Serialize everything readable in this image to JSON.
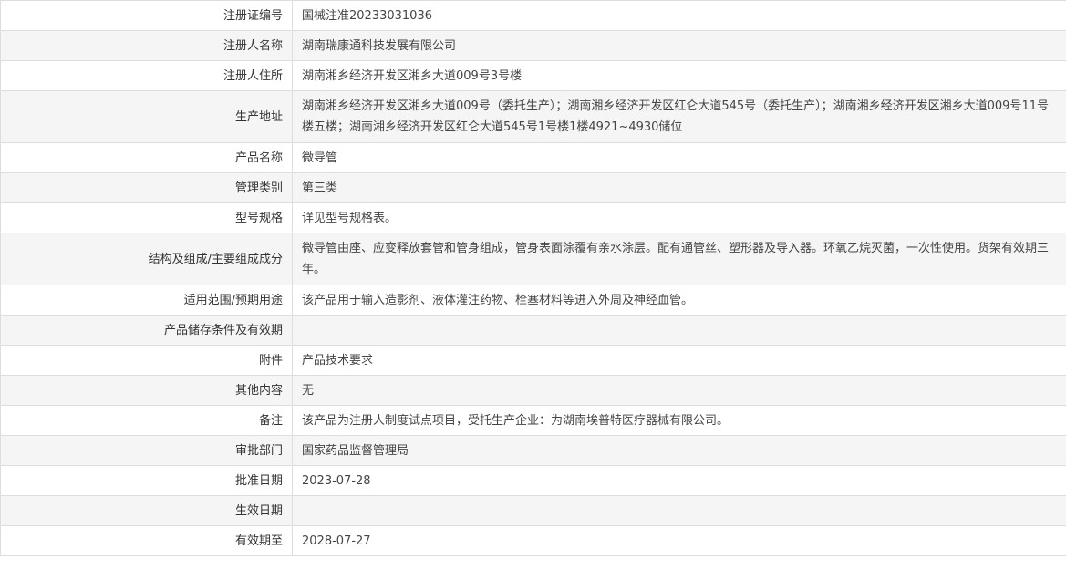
{
  "rows": [
    {
      "label": "注册证编号",
      "value": "国械注准20233031036"
    },
    {
      "label": "注册人名称",
      "value": "湖南瑞康通科技发展有限公司"
    },
    {
      "label": "注册人住所",
      "value": "湖南湘乡经济开发区湘乡大道009号3号楼"
    },
    {
      "label": "生产地址",
      "value": "湖南湘乡经济开发区湘乡大道009号（委托生产）；湖南湘乡经济开发区红仑大道545号（委托生产）；湖南湘乡经济开发区湘乡大道009号11号楼五楼；湖南湘乡经济开发区红仑大道545号1号楼1楼4921~4930储位"
    },
    {
      "label": "产品名称",
      "value": "微导管"
    },
    {
      "label": "管理类别",
      "value": "第三类"
    },
    {
      "label": "型号规格",
      "value": "详见型号规格表。"
    },
    {
      "label": "结构及组成/主要组成成分",
      "value": "微导管由座、应变释放套管和管身组成，管身表面涂覆有亲水涂层。配有通管丝、塑形器及导入器。环氧乙烷灭菌，一次性使用。货架有效期三年。"
    },
    {
      "label": "适用范围/预期用途",
      "value": "该产品用于输入造影剂、液体灌注药物、栓塞材料等进入外周及神经血管。"
    },
    {
      "label": "产品储存条件及有效期",
      "value": ""
    },
    {
      "label": "附件",
      "value": "产品技术要求"
    },
    {
      "label": "其他内容",
      "value": "无"
    },
    {
      "label": "备注",
      "value": "该产品为注册人制度试点项目，受托生产企业：为湖南埃普特医疗器械有限公司。"
    },
    {
      "label": "审批部门",
      "value": "国家药品监督管理局"
    },
    {
      "label": "批准日期",
      "value": "2023-07-28"
    },
    {
      "label": "生效日期",
      "value": ""
    },
    {
      "label": "有效期至",
      "value": "2028-07-27"
    }
  ]
}
